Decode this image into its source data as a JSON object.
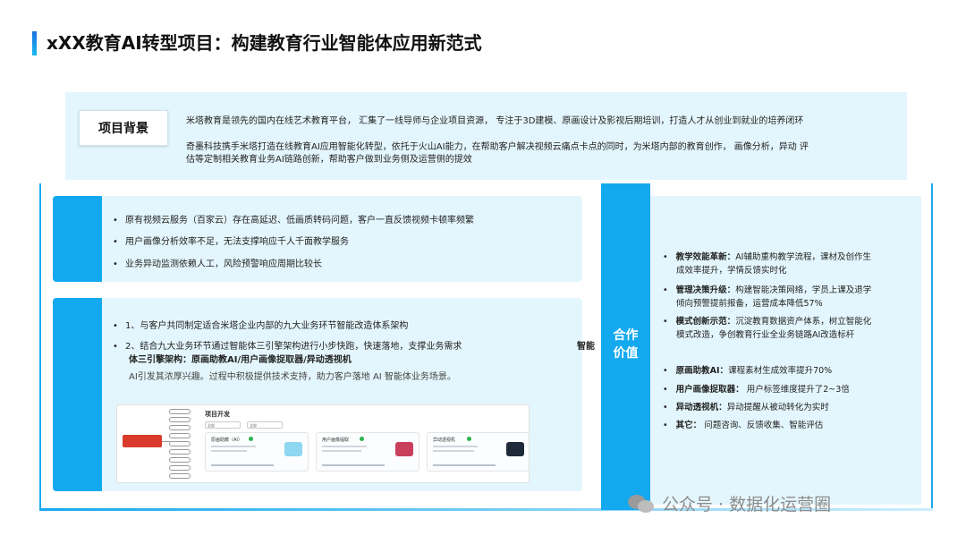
{
  "header": {
    "title": "xXX教育AI转型项目：构建教育行业智能体应用新范式"
  },
  "background": {
    "label": "项目背景",
    "para1": "米塔教育是领先的国内在线艺术教育平台， 汇集了一线导师与企业项目资源， 专注于3D建模、原画设计及影视后期培训，打造人才从创业到就业的培养闭环",
    "para2_line1": "奇墨科技携手米塔打造在线教育AI应用智能化转型，依托于火山AI能力，在帮助客户解决视频云痛点卡点的同时，为米塔内部的教育创作， 画像分析，异动        评",
    "para2_line2": "估等定制相关教育业务AI链路创新，帮助客户做到业务侧及运营侧的提效"
  },
  "pain_points": {
    "items": [
      "原有视频云服务（百家云）存在高延迟、低画质转码问题，客户一直反馈视频卡顿率频繁",
      "用户画像分析效率不足，无法支撑响应千人千面教学服务",
      "业务异动监测依赖人工，风险预警响应周期比较长"
    ]
  },
  "solution": {
    "item1": "1、与客户共同制定适合米塔企业内部的九大业务环节智能改造体系架构",
    "item2_line1": "2、结合九大业务环节通过智能体三引擎架构进行小步快跑，快速落地，支撑业务需求",
    "item2_tail": "智能",
    "item2_line2": "体三引擎架构：原画助教AI/用户画像捉取器/异动透视机",
    "item2_line3": "AI引发其浓厚兴趣。过程中积极提供技术支持，助力客户落地 AI 智能体业务场景。"
  },
  "mockup": {
    "title": "项目开发",
    "select1": "全部",
    "select2": "全部",
    "cards": [
      "原画助教（AI）",
      "用户画像提取",
      "异动透视机"
    ]
  },
  "cooperation": {
    "label_line1": "合作",
    "label_line2": "价值",
    "value_items": [
      {
        "title": "教学效能革新：",
        "text": "AI辅助重构教学流程，课材及创作生",
        "text2": "成效率提升，学情反馈实时化"
      },
      {
        "title": "管理决策升级：",
        "text": "构建智能决策网络，学员上课及退学",
        "text2": "倾向预警提前报备，运营成本降低57%"
      },
      {
        "title": "模式创新示范：",
        "text": "沉淀教育数据资产体系，树立智能化",
        "text2": "模式改造，争创教育行业全业务链路AI改造标杆"
      }
    ],
    "result_items": [
      {
        "title": "原画助教AI：",
        "text": "课程素材生成效率提升70%"
      },
      {
        "title": "用户画像捉取器：",
        "text": "用户标签维度提升了2~3倍"
      },
      {
        "title": "异动透视机：",
        "text": "异动提醒从被动转化为实时"
      },
      {
        "title": "其它：",
        "text": "问题咨询、反馈收集、智能评估"
      }
    ]
  },
  "watermark": {
    "text": "公众号 · 数据化运营圈"
  },
  "colors": {
    "accent": "#13a9ee",
    "panel": "#e4f6fd",
    "mind_center": "#d93a2b"
  }
}
